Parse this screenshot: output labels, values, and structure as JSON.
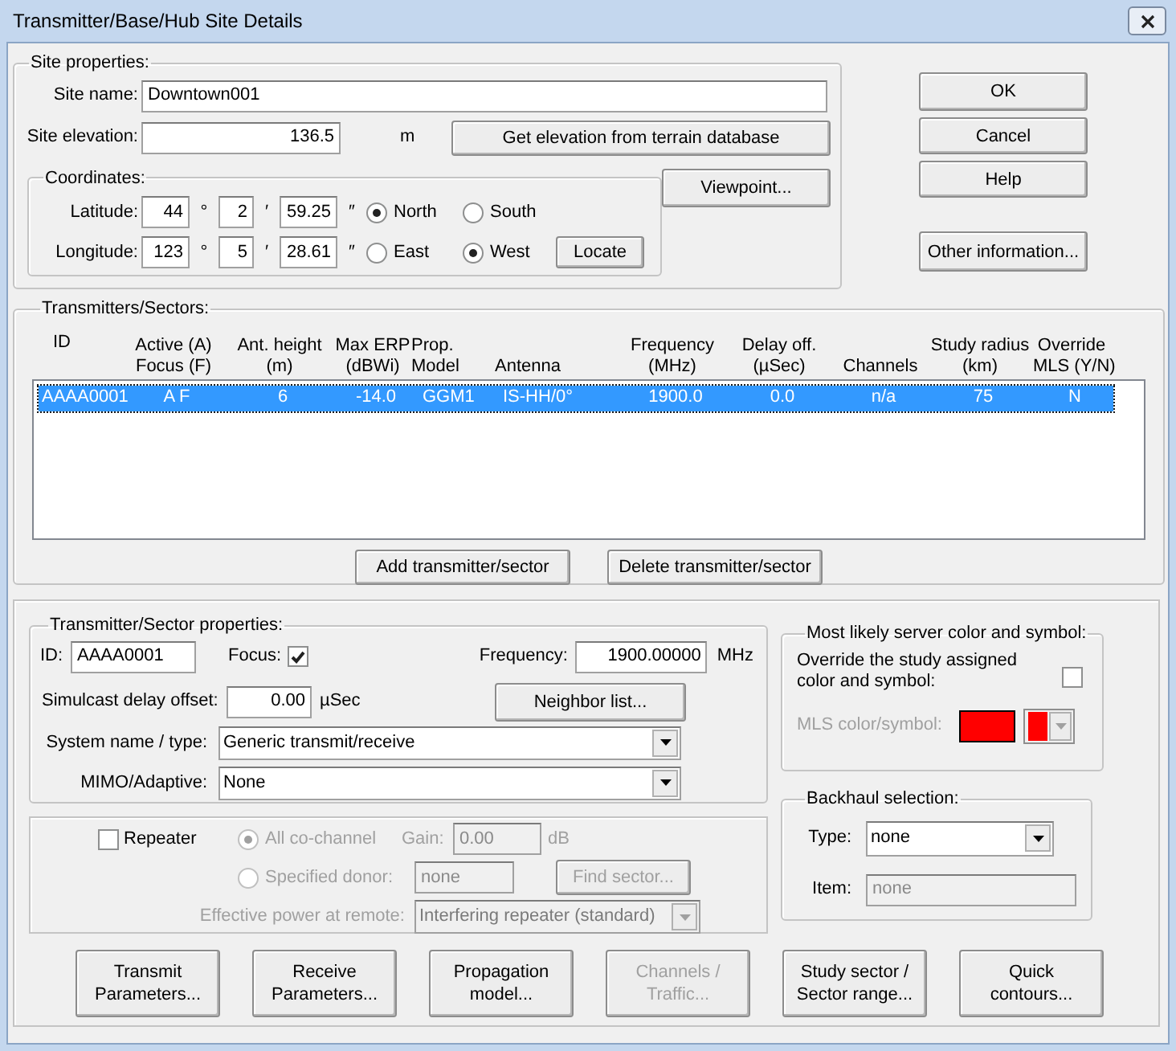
{
  "window": {
    "title": "Transmitter/Base/Hub Site Details"
  },
  "site_properties": {
    "title": "Site properties:",
    "site_name": {
      "label": "Site name:",
      "value": "Downtown001"
    },
    "site_elevation": {
      "label": "Site elevation:",
      "value": "136.5",
      "unit": "m"
    },
    "elevation_button": "Get elevation from terrain database",
    "coordinates": {
      "title": "Coordinates:",
      "rows": [
        {
          "label": "Latitude:",
          "degrees": "44",
          "minutes": "2",
          "seconds": "59.25",
          "marks": [
            "°",
            "′",
            "″"
          ],
          "options": [
            {
              "label": "North",
              "selected": true
            },
            {
              "label": "South",
              "selected": false
            }
          ]
        },
        {
          "label": "Longitude:",
          "degrees": "123",
          "minutes": "5",
          "seconds": "28.61",
          "marks": [
            "°",
            "′",
            "″"
          ],
          "options": [
            {
              "label": "East",
              "selected": false
            },
            {
              "label": "West",
              "selected": true
            }
          ]
        }
      ],
      "locate_button": "Locate"
    },
    "viewpoint_button": "Viewpoint..."
  },
  "dialog_buttons": [
    {
      "label": "OK"
    },
    {
      "label": "Cancel"
    },
    {
      "label": "Help"
    },
    {
      "label": "Other information..."
    }
  ],
  "transmitters": {
    "title": "Transmitters/Sectors:",
    "columns": [
      "ID",
      "Active (A)\nFocus (F)",
      "Ant. height\n(m)",
      "Max ERP\n(dBWi)",
      "Prop.\nModel",
      "Antenna",
      "Frequency\n(MHz)",
      "Delay off.\n(µSec)",
      "Channels",
      "Study radius\n(km)",
      "Override\nMLS (Y/N)"
    ],
    "rows": [
      {
        "selected": true,
        "cells": [
          "AAAA0001",
          "A F",
          "6",
          "-14.0",
          "GGM1",
          "IS-HH/0°",
          "1900.0",
          "0.0",
          "n/a",
          "75",
          "N"
        ]
      }
    ],
    "buttons": [
      "Add transmitter/sector",
      "Delete transmitter/sector"
    ]
  },
  "sector_properties": {
    "title": "Transmitter/Sector properties:",
    "id": {
      "label": "ID:",
      "value": "AAAA0001"
    },
    "focus": {
      "label": "Focus:",
      "checked": true
    },
    "frequency": {
      "label": "Frequency:",
      "value": "1900.00000",
      "unit": "MHz"
    },
    "simulcast": {
      "label": "Simulcast delay offset:",
      "value": "0.00",
      "unit": "µSec"
    },
    "neighbor_button": "Neighbor list...",
    "system": {
      "label": "System name / type:",
      "value": "Generic transmit/receive"
    },
    "mimo": {
      "label": "MIMO/Adaptive:",
      "value": "None"
    }
  },
  "repeater": {
    "label": "Repeater",
    "checked": false,
    "all_co_channel": {
      "label": "All co-channel",
      "selected": true,
      "disabled": true
    },
    "gain": {
      "label": "Gain:",
      "value": "0.00",
      "unit": "dB",
      "disabled": true
    },
    "specified_donor": {
      "label": "Specified donor:",
      "selected": false,
      "disabled": true
    },
    "donor": {
      "value": "none",
      "disabled": true
    },
    "find_sector_button": {
      "label": "Find sector...",
      "disabled": true
    },
    "effective_power": {
      "label": "Effective power at remote:",
      "value": "Interfering repeater (standard)",
      "disabled": true
    }
  },
  "mls": {
    "title": "Most likely server color and symbol:",
    "override": {
      "label": "Override the study assigned\ncolor and symbol:",
      "checked": false
    },
    "color_symbol": {
      "label": "MLS color/symbol:",
      "color": "#ff0000",
      "disabled": true
    }
  },
  "backhaul": {
    "title": "Backhaul selection:",
    "type": {
      "label": "Type:",
      "value": "none"
    },
    "item": {
      "label": "Item:",
      "value": "none",
      "disabled": true
    }
  },
  "bottom_buttons": [
    {
      "label": "Transmit\nParameters...",
      "disabled": false
    },
    {
      "label": "Receive\nParameters...",
      "disabled": false
    },
    {
      "label": "Propagation\nmodel...",
      "disabled": false
    },
    {
      "label": "Channels /\nTraffic...",
      "disabled": true
    },
    {
      "label": "Study sector /\nSector range...",
      "disabled": false
    },
    {
      "label": "Quick\ncontours...",
      "disabled": false
    }
  ]
}
